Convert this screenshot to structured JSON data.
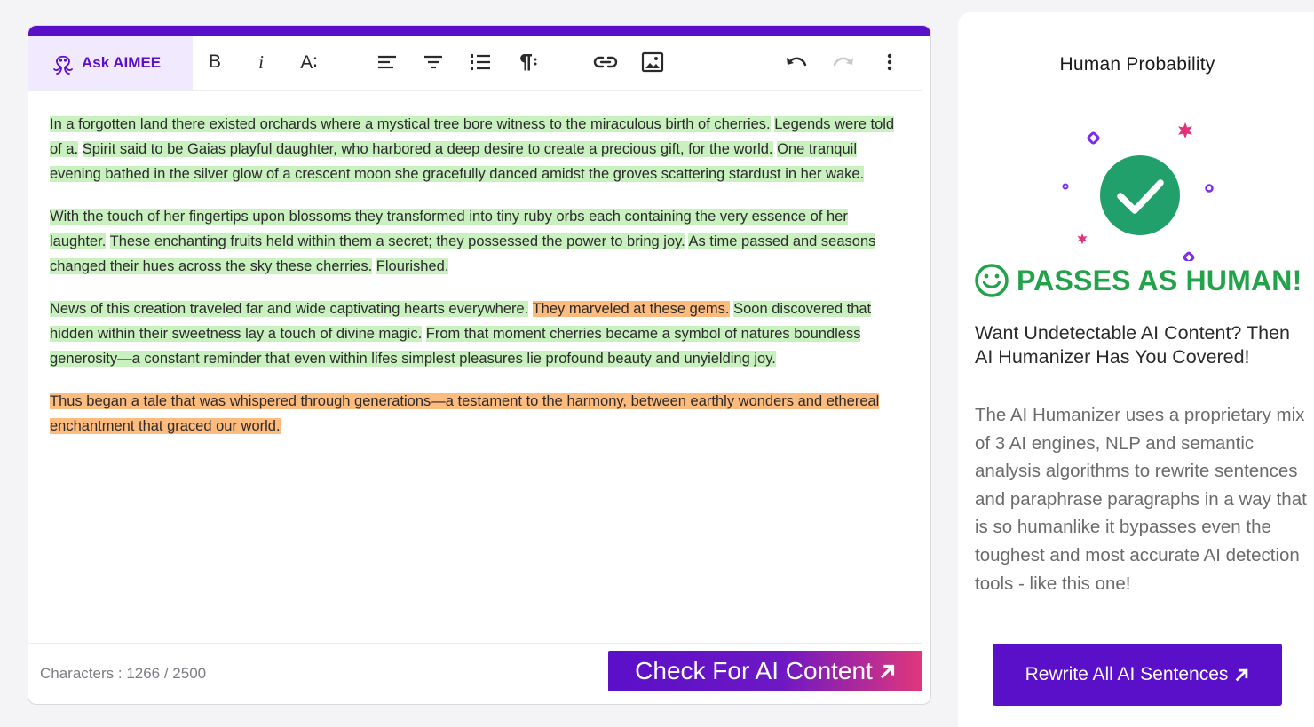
{
  "editor": {
    "ask_label": "Ask AIMEE",
    "toolbar": {
      "bold_label": "B",
      "italic_label": "i",
      "font_size_label": "A∶"
    },
    "paragraphs": [
      {
        "segments": [
          {
            "text": "In a forgotten land there existed orchards where a mystical tree bore witness to the miraculous birth of cherries.",
            "status": "human"
          },
          {
            "text": "Legends were told of a.",
            "status": "human"
          },
          {
            "text": "Spirit said to be Gaias playful daughter, who harbored a deep desire to create a precious gift, for the world.",
            "status": "human"
          },
          {
            "text": "One tranquil evening bathed in the silver glow of a crescent moon she gracefully danced amidst the groves scattering stardust in her wake.",
            "status": "human"
          }
        ]
      },
      {
        "segments": [
          {
            "text": "With the touch of her fingertips upon blossoms they transformed into tiny ruby orbs each containing the very essence of her laughter.",
            "status": "human"
          },
          {
            "text": "These enchanting fruits held within them a secret; they possessed the power to bring joy.",
            "status": "human"
          },
          {
            "text": "As time passed and seasons changed their hues across the sky these cherries.",
            "status": "human"
          },
          {
            "text": "Flourished.",
            "status": "human"
          }
        ]
      },
      {
        "segments": [
          {
            "text": "News of this creation traveled far and wide captivating hearts everywhere.",
            "status": "human"
          },
          {
            "text": "They marveled at these gems.",
            "status": "ai"
          },
          {
            "text": "Soon discovered that hidden within their sweetness lay a touch of divine magic.",
            "status": "human"
          },
          {
            "text": "From that moment cherries became a symbol of natures boundless generosity—a constant reminder that even within lifes simplest pleasures lie profound beauty and unyielding joy.",
            "status": "human"
          }
        ]
      },
      {
        "segments": [
          {
            "text": "Thus began a tale that was whispered through generations—a testament to the harmony, between earthly wonders and ethereal enchantment that graced our world.",
            "status": "ai"
          }
        ]
      }
    ],
    "char_count_label": "Characters : ",
    "char_count": "1266",
    "char_limit": " / 2500",
    "check_button_label": "Check For AI Content"
  },
  "side_panel": {
    "title": "Human Probability",
    "result_label": "PASSES AS HUMAN!",
    "promo_heading": "Want Undetectable AI Content? Then AI Humanizer Has You Covered!",
    "promo_body": "The AI Humanizer uses a proprietary mix of 3 AI engines, NLP and semantic analysis algorithms to rewrite sentences and paraphrase paragraphs in a way that is so humanlike it bypasses even the toughest and most accurate AI detection tools - like this one!",
    "rewrite_button_label": "Rewrite All AI Sentences"
  },
  "colors": {
    "brand_purple": "#5a0fc8",
    "human_highlight": "#c9f0bf",
    "ai_highlight": "#fdbb7e",
    "pass_green": "#22a24a"
  }
}
